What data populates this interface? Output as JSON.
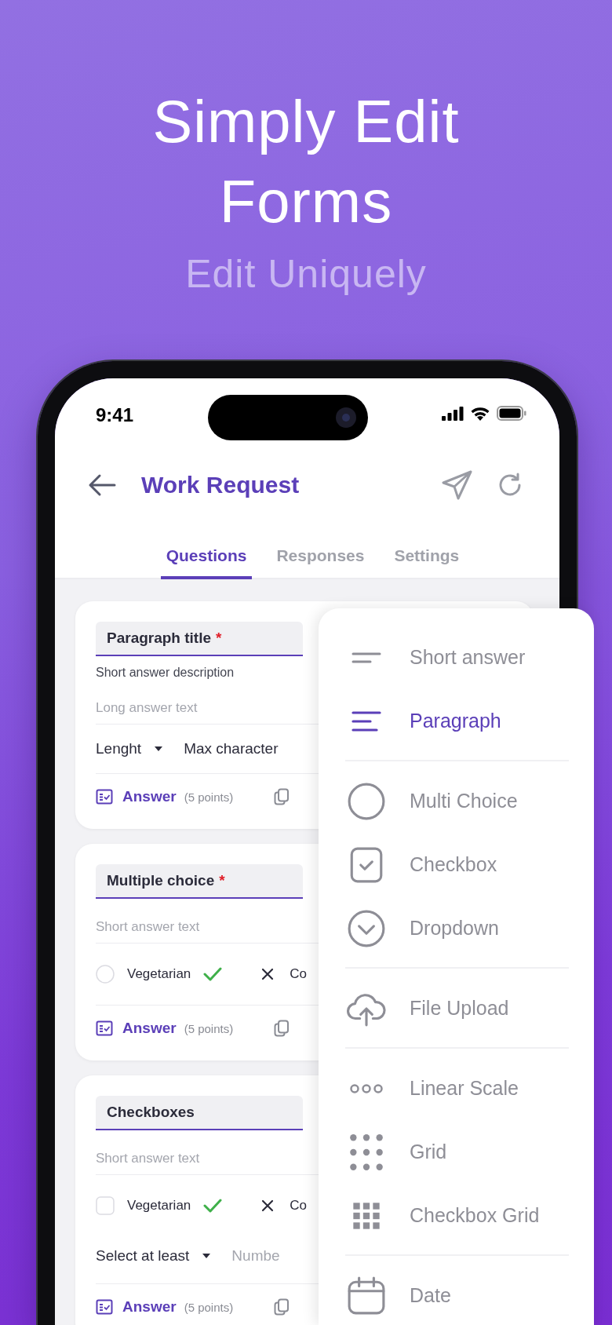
{
  "hero": {
    "title": "Simply Edit Forms",
    "subtitle": "Edit Uniquely"
  },
  "status_bar": {
    "time": "9:41"
  },
  "header": {
    "title": "Work Request"
  },
  "tabs": [
    {
      "label": "Questions",
      "selected": true
    },
    {
      "label": "Responses",
      "selected": false
    },
    {
      "label": "Settings",
      "selected": false
    }
  ],
  "questions": [
    {
      "kind": "paragraph",
      "title": "Paragraph title",
      "required_mark": "*",
      "description": "Short answer description",
      "answer_placeholder": "Long answer text",
      "setting": {
        "dropdown": "Lenght",
        "value": "Max character"
      },
      "answer_label": "Answer",
      "points": "(5 points)"
    },
    {
      "kind": "choice",
      "title": "Multiple choice",
      "required_mark": "*",
      "answer_placeholder": "Short answer text",
      "option": {
        "kind": "radio",
        "label": "Vegetarian",
        "checked": false
      },
      "next_option": "Co",
      "answer_label": "Answer",
      "points": "(5 points)"
    },
    {
      "kind": "choice",
      "title": "Checkboxes",
      "answer_placeholder": "Short answer text",
      "option": {
        "kind": "checkbox",
        "label": "Vegetarian",
        "checked": false
      },
      "next_option": "Co",
      "rule": {
        "dropdown": "Select at least",
        "placeholder": "Numbe"
      },
      "answer_label": "Answer",
      "points": "(5 points)"
    }
  ],
  "type_menu": [
    [
      {
        "kind": "short",
        "label": "Short answer",
        "selected": false
      },
      {
        "kind": "paragraph",
        "label": "Paragraph",
        "selected": true
      }
    ],
    [
      {
        "kind": "radio",
        "label": "Multi Choice",
        "selected": false
      },
      {
        "kind": "checkbox",
        "label": "Checkbox",
        "selected": false
      },
      {
        "kind": "dropdown",
        "label": "Dropdown",
        "selected": false
      }
    ],
    [
      {
        "kind": "upload",
        "label": "File Upload",
        "selected": false
      }
    ],
    [
      {
        "kind": "scale",
        "label": "Linear Scale",
        "selected": false
      },
      {
        "kind": "grid",
        "label": "Grid",
        "selected": false
      },
      {
        "kind": "checkgrid",
        "label": "Checkbox Grid",
        "selected": false
      }
    ],
    [
      {
        "kind": "date",
        "label": "Date",
        "selected": false
      }
    ]
  ]
}
